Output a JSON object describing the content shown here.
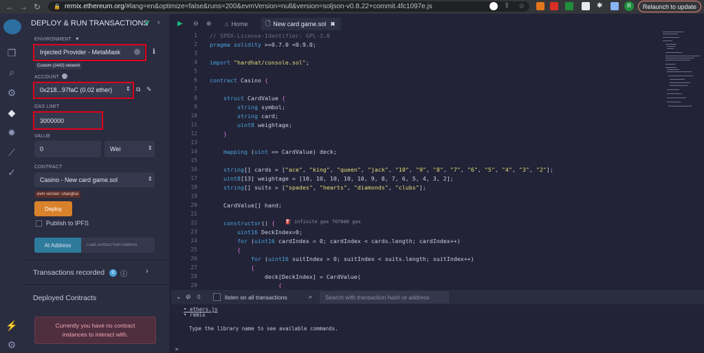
{
  "browser": {
    "back": "←",
    "forward": "→",
    "reload": "↻",
    "url_host": "remix.ethereum.org",
    "url_rest": "/#lang=en&optimize=false&runs=200&evmVersion=null&version=soljson-v0.8.22+commit.4fc1097e.js",
    "avatar_letter": "R",
    "relaunch_label": "Relaunch to update"
  },
  "panel": {
    "title": "DEPLOY & RUN TRANSACTIONS",
    "environment_label": "ENVIRONMENT",
    "environment_value": "Injected Provider - MetaMask",
    "network_badge": "Custom (1442) network",
    "account_label": "ACCOUNT",
    "account_value": "0x218...97faC (0.02 ether)",
    "gas_limit_label": "GAS LIMIT",
    "gas_limit_value": "3000000",
    "value_label": "VALUE",
    "value_amount": "0",
    "value_unit": "Wei",
    "contract_label": "CONTRACT",
    "contract_value": "Casino - New card game.sol",
    "evm_badge": "evm version: shanghai",
    "deploy_label": "Deploy",
    "publish_label": "Publish to IPFS",
    "at_address_label": "At Address",
    "load_placeholder": "Load contract from Address",
    "transactions_recorded": "Transactions recorded",
    "transactions_count": "0",
    "deployed_contracts": "Deployed Contracts",
    "no_contracts_msg": "Currently you have no contract instances to interact with."
  },
  "editor": {
    "tabs": [
      {
        "label": "Home"
      },
      {
        "label": "New card game.sol"
      }
    ],
    "gas_hint": "infinite gas 707000 gas",
    "line_numbers": [
      "1",
      "2",
      "3",
      "4",
      "5",
      "6",
      "7",
      "8",
      "9",
      "10",
      "11",
      "12",
      "13",
      "14",
      "15",
      "16",
      "17",
      "18",
      "19",
      "20",
      "21",
      "22",
      "23",
      "24",
      "25",
      "26",
      "27",
      "28",
      "29"
    ]
  },
  "terminal": {
    "count": "0",
    "listen_label": "listen on all transactions",
    "search_placeholder": "Search with transaction hash or address",
    "lines": [
      "• ethers.js",
      "• remix",
      "Type the library name to see available commands."
    ],
    "prompt": ">"
  }
}
